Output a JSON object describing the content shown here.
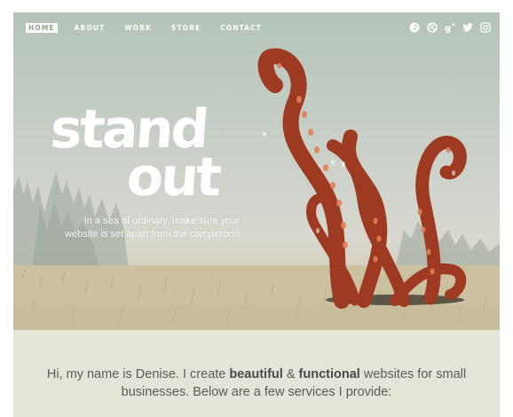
{
  "nav": {
    "items": [
      {
        "label": "HOME",
        "active": true
      },
      {
        "label": "ABOUT",
        "active": false
      },
      {
        "label": "WORK",
        "active": false
      },
      {
        "label": "STORE",
        "active": false
      },
      {
        "label": "CONTACT",
        "active": false
      }
    ]
  },
  "social": [
    "pinterest-icon",
    "dribbble-icon",
    "google-plus-icon",
    "twitter-icon",
    "instagram-icon"
  ],
  "hero": {
    "headline_line1": "stand",
    "headline_line2": "out",
    "tagline_line1": "In a sea of ordinary, make sure your",
    "tagline_line2": "website is set apart from the competition"
  },
  "intro": {
    "part1": "Hi, my name is Denise. I create ",
    "bold1": "beautiful",
    "part2": " & ",
    "bold2": "functional",
    "part3": " websites for small businesses. Below are a few services I provide:"
  },
  "colors": {
    "tentacle": "#9e3a22",
    "sucker": "#e0805a",
    "intro_bg": "#e4e5d8",
    "text": "#5b5b5b"
  }
}
